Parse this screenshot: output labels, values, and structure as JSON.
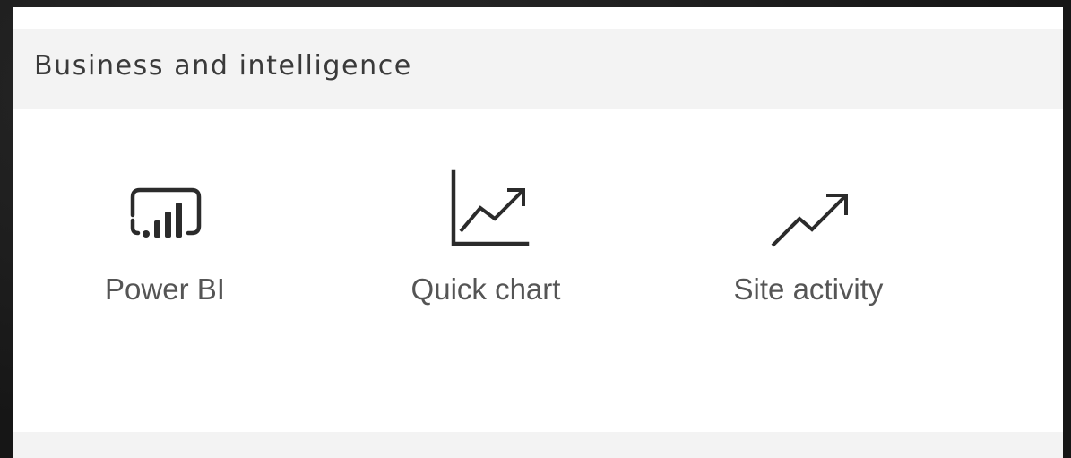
{
  "section": {
    "title": "Business and intelligence"
  },
  "tiles": [
    {
      "label": "Power BI",
      "icon": "power-bi-icon"
    },
    {
      "label": "Quick chart",
      "icon": "line-chart-icon"
    },
    {
      "label": "Site activity",
      "icon": "trending-up-icon"
    }
  ],
  "colors": {
    "header_bg": "#f3f3f3",
    "panel_bg": "#ffffff",
    "icon_color": "#2b2b2b",
    "label_color": "#555555"
  }
}
